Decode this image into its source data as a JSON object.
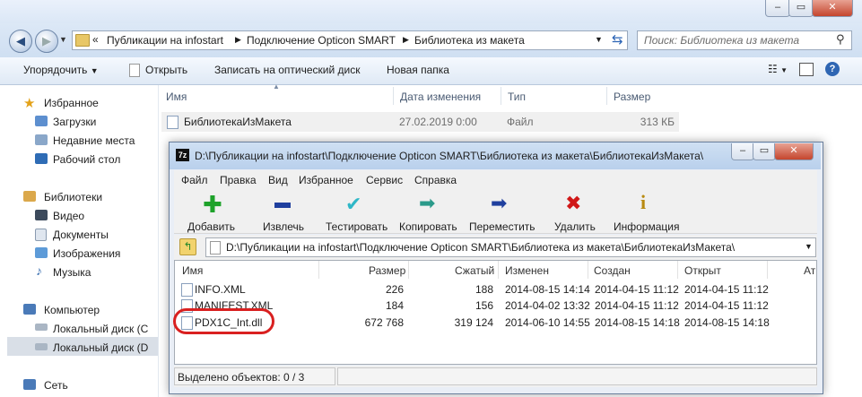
{
  "explorer": {
    "breadcrumb": [
      "Публикации на infostart",
      "Подключение Opticon SMART",
      "Библиотека из макета"
    ],
    "search_placeholder": "Поиск: Библиотека из макета",
    "toolbar": {
      "organize": "Упорядочить",
      "open": "Открыть",
      "burn": "Записать на оптический диск",
      "new_folder": "Новая папка"
    },
    "columns": {
      "name": "Имя",
      "modified": "Дата изменения",
      "type": "Тип",
      "size": "Размер"
    },
    "file": {
      "name": "БиблиотекаИзМакета",
      "modified": "27.02.2019 0:00",
      "type": "Файл",
      "size": "313 КБ"
    },
    "nav": {
      "favorites": "Избранное",
      "downloads": "Загрузки",
      "recent": "Недавние места",
      "desktop": "Рабочий стол",
      "libraries": "Библиотеки",
      "video": "Видео",
      "documents": "Документы",
      "images": "Изображения",
      "music": "Музыка",
      "computer": "Компьютер",
      "disk_c": "Локальный диск (C",
      "disk_d": "Локальный диск (D",
      "network": "Сеть"
    }
  },
  "sevenzip": {
    "logo": "7z",
    "title": "D:\\Публикации на infostart\\Подключение Opticon SMART\\Библиотека из макета\\БиблиотекаИзМакета\\",
    "menu": [
      "Файл",
      "Правка",
      "Вид",
      "Избранное",
      "Сервис",
      "Справка"
    ],
    "tools": [
      "Добавить",
      "Извлечь",
      "Тестировать",
      "Копировать",
      "Переместить",
      "Удалить",
      "Информация"
    ],
    "path": "D:\\Публикации на infostart\\Подключение Opticon SMART\\Библиотека из макета\\БиблиотекаИзМакета\\",
    "columns": [
      "Имя",
      "Размер",
      "Сжатый",
      "Изменен",
      "Создан",
      "Открыт",
      "Ат"
    ],
    "files": [
      {
        "name": "INFO.XML",
        "size": "226",
        "packed": "188",
        "modified": "2014-08-15 14:14",
        "created": "2014-04-15 11:12",
        "accessed": "2014-04-15 11:12"
      },
      {
        "name": "MANIFEST.XML",
        "size": "184",
        "packed": "156",
        "modified": "2014-04-02 13:32",
        "created": "2014-04-15 11:12",
        "accessed": "2014-04-15 11:12"
      },
      {
        "name": "PDX1C_Int.dll",
        "size": "672 768",
        "packed": "319 124",
        "modified": "2014-06-10 14:55",
        "created": "2014-08-15 14:18",
        "accessed": "2014-08-15 14:18"
      }
    ],
    "status": "Выделено объектов: 0 / 3",
    "highlight_color": "#d92020"
  }
}
